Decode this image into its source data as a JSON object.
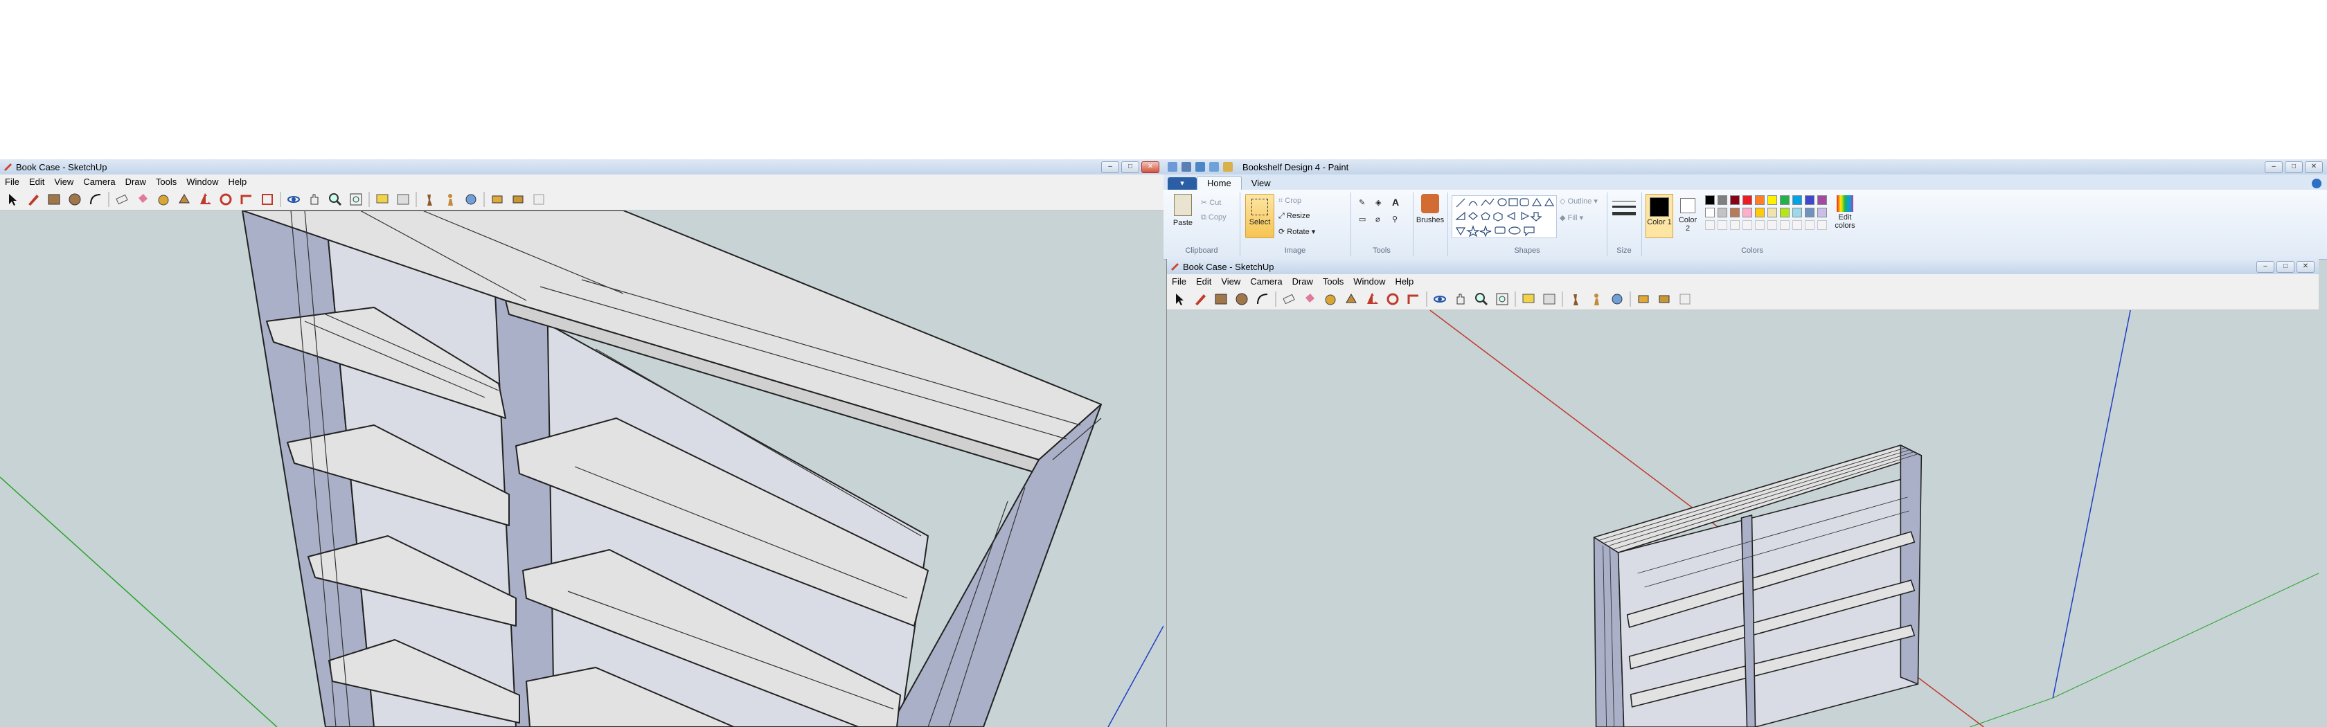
{
  "left_window": {
    "title": "Book Case - SketchUp",
    "menu": [
      "File",
      "Edit",
      "View",
      "Camera",
      "Draw",
      "Tools",
      "Window",
      "Help"
    ],
    "tools": [
      "select-icon",
      "pencil-icon",
      "rectangle-icon",
      "circle-icon",
      "arc-icon",
      "eraser-icon",
      "paint-bucket-icon",
      "tape-measure-icon",
      "push-pull-icon",
      "move-icon",
      "rotate-icon",
      "follow-me-icon",
      "scale-icon",
      "offset-icon",
      "orbit-icon",
      "pan-icon",
      "zoom-icon",
      "zoom-extents-icon",
      "text-icon",
      "section-icon",
      "walk-icon",
      "position-camera-icon",
      "look-around-icon",
      "components-icon",
      "warehouse-icon",
      "extension-icon"
    ]
  },
  "paint_window": {
    "title": "Bookshelf Design 4 - Paint",
    "tabs": {
      "file": "▾",
      "home": "Home",
      "view": "View"
    },
    "clipboard": {
      "paste": "Paste",
      "cut": "Cut",
      "copy": "Copy",
      "label": "Clipboard"
    },
    "image": {
      "select": "Select",
      "crop": "Crop",
      "resize": "Resize",
      "rotate": "Rotate",
      "label": "Image"
    },
    "tools": {
      "label": "Tools"
    },
    "brushes": {
      "label": "Brushes"
    },
    "shapes": {
      "outline": "Outline",
      "fill": "Fill",
      "label": "Shapes"
    },
    "size": {
      "label": "Size"
    },
    "colors": {
      "color1": "Color 1",
      "color2": "Color 2",
      "edit": "Edit colors",
      "label": "Colors",
      "palette": [
        "#000000",
        "#7f7f7f",
        "#880015",
        "#ed1c24",
        "#ff7f27",
        "#fff200",
        "#22b14c",
        "#00a2e8",
        "#3f48cc",
        "#a349a4",
        "#ffffff",
        "#c3c3c3",
        "#b97a57",
        "#ffaec9",
        "#ffc90e",
        "#efe4b0",
        "#b5e61d",
        "#99d9ea",
        "#7092be",
        "#c8bfe7"
      ]
    }
  },
  "inner_window": {
    "title": "Book Case - SketchUp",
    "menu": [
      "File",
      "Edit",
      "View",
      "Camera",
      "Draw",
      "Tools",
      "Window",
      "Help"
    ]
  },
  "colors": {
    "sky": "#c7d3d5",
    "shelf_top": "#e2e2e2",
    "shelf_side": "#aab0c8",
    "edge": "#222222",
    "axis_red": "#c0392b",
    "axis_green": "#27a327",
    "axis_blue": "#1f3fc4"
  }
}
